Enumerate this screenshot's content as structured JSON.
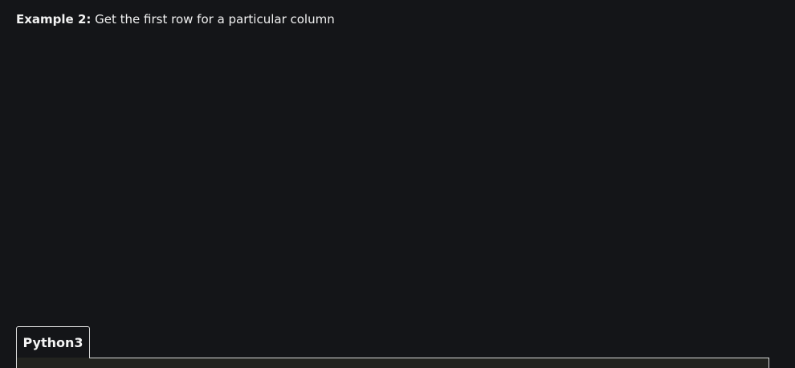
{
  "heading": {
    "label": "Example 2:",
    "text": " Get the first row for a particular column"
  },
  "code_tabs": {
    "active_tab": "Python3"
  },
  "colors": {
    "background": "#141518",
    "text": "#f2f2f2",
    "border": "#d9d9d9",
    "code_background": "#22231f"
  }
}
